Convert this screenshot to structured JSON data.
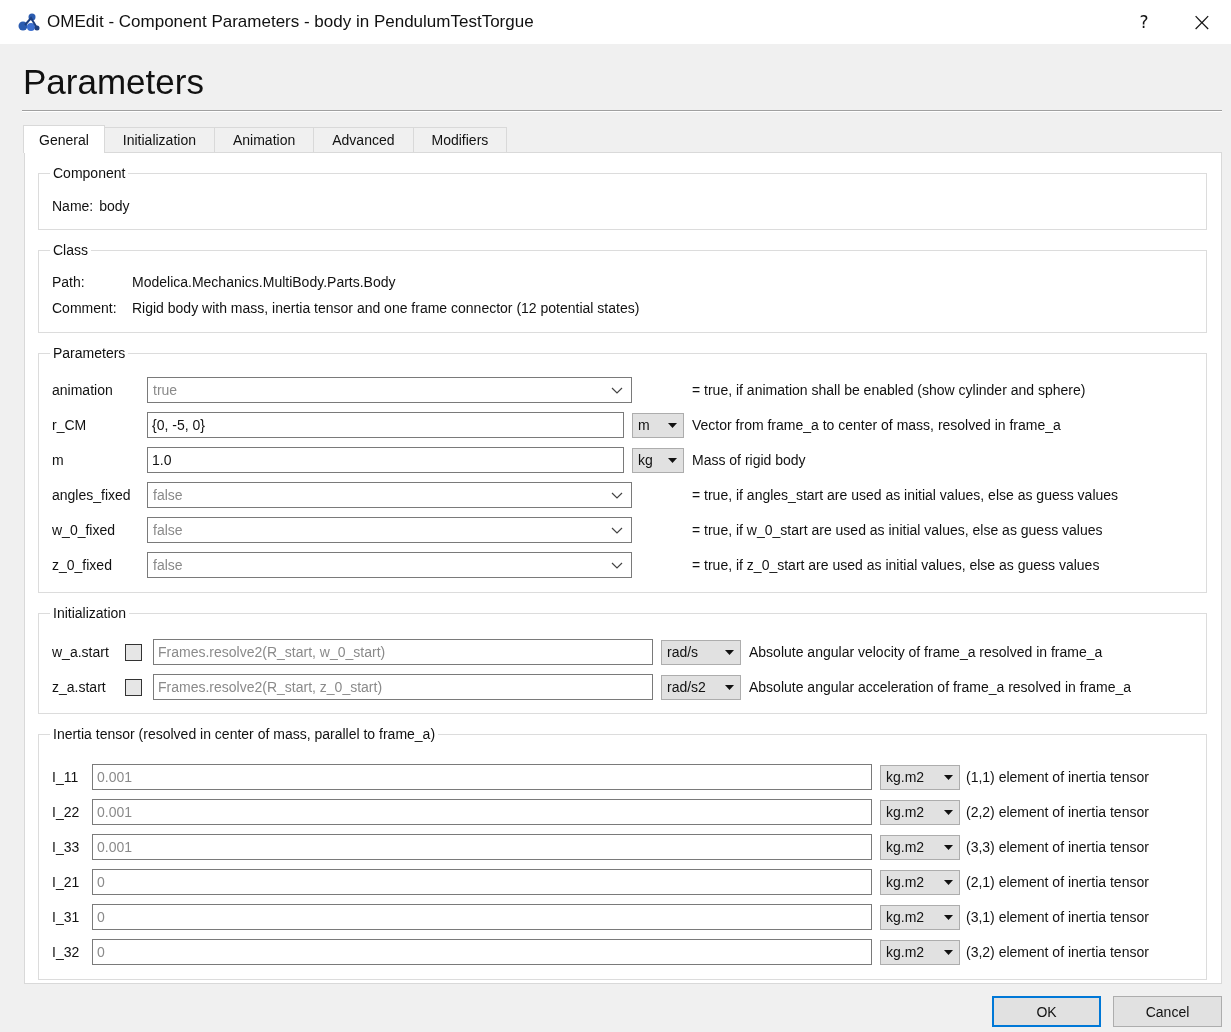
{
  "window": {
    "title": "OMEdit - Component Parameters - body in PendulumTestTorgue",
    "help": "?",
    "close": "×"
  },
  "heading": "Parameters",
  "tabs": [
    {
      "label": "General",
      "selected": true
    },
    {
      "label": "Initialization",
      "selected": false
    },
    {
      "label": "Animation",
      "selected": false
    },
    {
      "label": "Advanced",
      "selected": false
    },
    {
      "label": "Modifiers",
      "selected": false
    }
  ],
  "component": {
    "title": "Component",
    "name_label": "Name:",
    "name": "body"
  },
  "class": {
    "title": "Class",
    "rows": [
      {
        "label": "Path:",
        "value": "Modelica.Mechanics.MultiBody.Parts.Body"
      },
      {
        "label": "Comment:",
        "value": "Rigid body with mass, inertia tensor and one frame connector (12 potential states)"
      }
    ]
  },
  "parameters": {
    "title": "Parameters",
    "rows": [
      {
        "kind": "combo",
        "label": "animation",
        "placeholder": "true",
        "comment": "= true, if animation shall be enabled (show cylinder and sphere)"
      },
      {
        "kind": "input",
        "label": "r_CM",
        "value": "{0, -5, 0}",
        "unit": "m",
        "comment": "Vector from frame_a to center of mass, resolved in frame_a"
      },
      {
        "kind": "input",
        "label": "m",
        "value": "1.0",
        "unit": "kg",
        "comment": "Mass of rigid body"
      },
      {
        "kind": "combo",
        "label": "angles_fixed",
        "placeholder": "false",
        "comment": "= true, if angles_start are used as initial values, else as guess values"
      },
      {
        "kind": "combo",
        "label": "w_0_fixed",
        "placeholder": "false",
        "comment": "= true, if w_0_start are used as initial values, else as guess values"
      },
      {
        "kind": "combo",
        "label": "z_0_fixed",
        "placeholder": "false",
        "comment": "= true, if z_0_start are used as initial values, else as guess values"
      }
    ]
  },
  "initialization": {
    "title": "Initialization",
    "rows": [
      {
        "label": "w_a.start",
        "checked": false,
        "placeholder": "Frames.resolve2(R_start, w_0_start)",
        "unit": "rad/s",
        "comment": "Absolute angular velocity of frame_a resolved in frame_a"
      },
      {
        "label": "z_a.start",
        "checked": false,
        "placeholder": "Frames.resolve2(R_start, z_0_start)",
        "unit": "rad/s2",
        "comment": "Absolute angular acceleration of frame_a resolved in frame_a"
      }
    ]
  },
  "inertia": {
    "title": "Inertia tensor (resolved in center of mass, parallel to frame_a)",
    "rows": [
      {
        "label": "I_11",
        "placeholder": "0.001",
        "unit": "kg.m2",
        "comment": "(1,1) element of inertia tensor"
      },
      {
        "label": "I_22",
        "placeholder": "0.001",
        "unit": "kg.m2",
        "comment": "(2,2) element of inertia tensor"
      },
      {
        "label": "I_33",
        "placeholder": "0.001",
        "unit": "kg.m2",
        "comment": "(3,3) element of inertia tensor"
      },
      {
        "label": "I_21",
        "placeholder": "0",
        "unit": "kg.m2",
        "comment": "(2,1) element of inertia tensor"
      },
      {
        "label": "I_31",
        "placeholder": "0",
        "unit": "kg.m2",
        "comment": "(3,1) element of inertia tensor"
      },
      {
        "label": "I_32",
        "placeholder": "0",
        "unit": "kg.m2",
        "comment": "(3,2) element of inertia tensor"
      }
    ]
  },
  "buttons": [
    {
      "label": "OK",
      "default": true
    },
    {
      "label": "Cancel",
      "default": false
    }
  ]
}
